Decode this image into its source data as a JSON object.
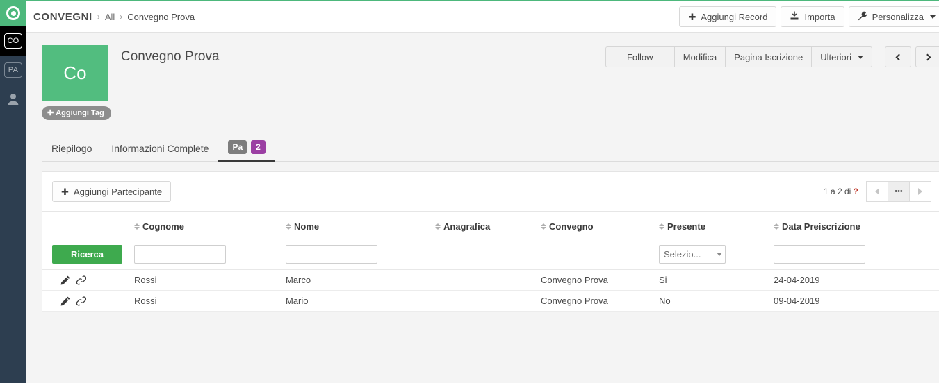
{
  "rail": {
    "logo_icon": "target-icon",
    "items": [
      {
        "label": "CO",
        "name": "rail-item-co",
        "active": true
      },
      {
        "label": "PA",
        "name": "rail-item-pa",
        "active": false
      }
    ],
    "user_icon": "user-icon"
  },
  "topbar": {
    "module": "CONVEGNI",
    "sep": "›",
    "crumb_all": "All",
    "crumb_current": "Convegno Prova",
    "add_record": "Aggiungi Record",
    "import": "Importa",
    "customize": "Personalizza"
  },
  "record": {
    "avatar_initials": "Co",
    "avatar_color": "#52bd7f",
    "title": "Convegno Prova",
    "add_tag": "Aggiungi Tag",
    "actions": {
      "follow": "Follow",
      "edit": "Modifica",
      "subscription_page": "Pagina Iscrizione",
      "more": "Ulteriori"
    }
  },
  "tabs": [
    {
      "label": "Riepilogo",
      "name": "tab-riepilogo"
    },
    {
      "label": "Informazioni Complete",
      "name": "tab-informazioni-complete"
    }
  ],
  "active_tab": {
    "label": "Pa",
    "count": "2",
    "badge_color": "#9b3fa3"
  },
  "panel": {
    "add_participant": "Aggiungi Partecipante",
    "pager_text": "1 a 2 di",
    "pager_unknown": "?",
    "pager_more": "•••",
    "search_button": "Ricerca",
    "select_placeholder": "Selezio...",
    "columns": [
      "Cognome",
      "Nome",
      "Anagrafica",
      "Convegno",
      "Presente",
      "Data Preiscrizione"
    ],
    "filters": {
      "cognome": "",
      "nome": "",
      "anagrafica": "",
      "convegno": "",
      "presente": "Selezio...",
      "data_preiscrizione": ""
    },
    "rows": [
      {
        "cognome": "Rossi",
        "nome": "Marco",
        "anagrafica": "",
        "convegno": "Convegno Prova",
        "presente": "Si",
        "data": "24-04-2019"
      },
      {
        "cognome": "Rossi",
        "nome": "Mario",
        "anagrafica": "",
        "convegno": "Convegno Prova",
        "presente": "No",
        "data": "09-04-2019"
      }
    ]
  }
}
